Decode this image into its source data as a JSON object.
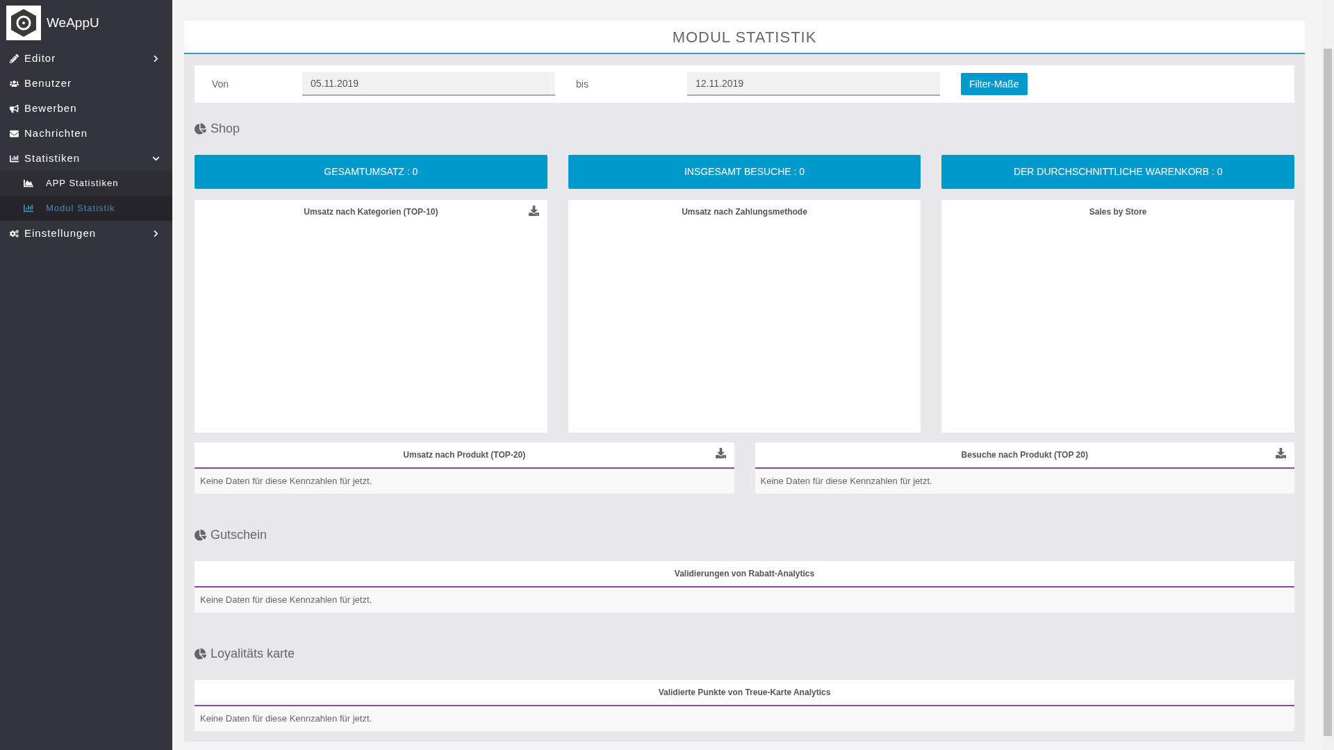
{
  "brand": {
    "name": "WeAppU"
  },
  "sidebar": {
    "items": [
      {
        "label": "Editor",
        "has_submenu": true,
        "expanded": false,
        "selected": false
      },
      {
        "label": "Benutzer",
        "has_submenu": false,
        "expanded": false,
        "selected": false
      },
      {
        "label": "Bewerben",
        "has_submenu": false,
        "expanded": false,
        "selected": false
      },
      {
        "label": "Nachrichten",
        "has_submenu": false,
        "expanded": false,
        "selected": false
      },
      {
        "label": "Statistiken",
        "has_submenu": true,
        "expanded": true,
        "selected": false,
        "children": [
          {
            "label": "APP Statistiken",
            "selected": false
          },
          {
            "label": "Modul Statistik",
            "selected": true
          }
        ]
      },
      {
        "label": "Einstellungen",
        "has_submenu": true,
        "expanded": false,
        "selected": false
      }
    ]
  },
  "page": {
    "title": "MODUL STATISTIK"
  },
  "filter": {
    "from_label": "Von",
    "from_value": "05.11.2019",
    "to_label": "bis",
    "to_value": "12.11.2019",
    "button": "Filter-Maße"
  },
  "sections": [
    {
      "title": "Shop",
      "kpis": [
        "GESAMTUMSATZ : 0",
        "INSGESAMT BESUCHE : 0",
        "DER DURCHSCHNITTLICHE WARENKORB : 0"
      ],
      "charts": [
        {
          "title": "Umsatz nach Kategorien (TOP-10)",
          "download": true
        },
        {
          "title": "Umsatz nach Zahlungsmethode",
          "download": false
        },
        {
          "title": "Sales by Store",
          "download": false
        }
      ],
      "tables": [
        {
          "title": "Umsatz nach Produkt (TOP-20)",
          "download": true,
          "message": "Keine Daten für diese Kennzahlen für jetzt."
        },
        {
          "title": "Besuche nach Produkt (TOP 20)",
          "download": true,
          "message": "Keine Daten für diese Kennzahlen für jetzt."
        }
      ]
    },
    {
      "title": "Gutschein",
      "tables": [
        {
          "title": "Validierungen von Rabatt-Analytics",
          "download": false,
          "message": "Keine Daten für diese Kennzahlen für jetzt."
        }
      ]
    },
    {
      "title": "Loyalitäts karte",
      "tables": [
        {
          "title": "Validierte Punkte von Treue-Karte Analytics",
          "download": false,
          "message": "Keine Daten für diese Kennzahlen für jetzt."
        }
      ]
    }
  ]
}
